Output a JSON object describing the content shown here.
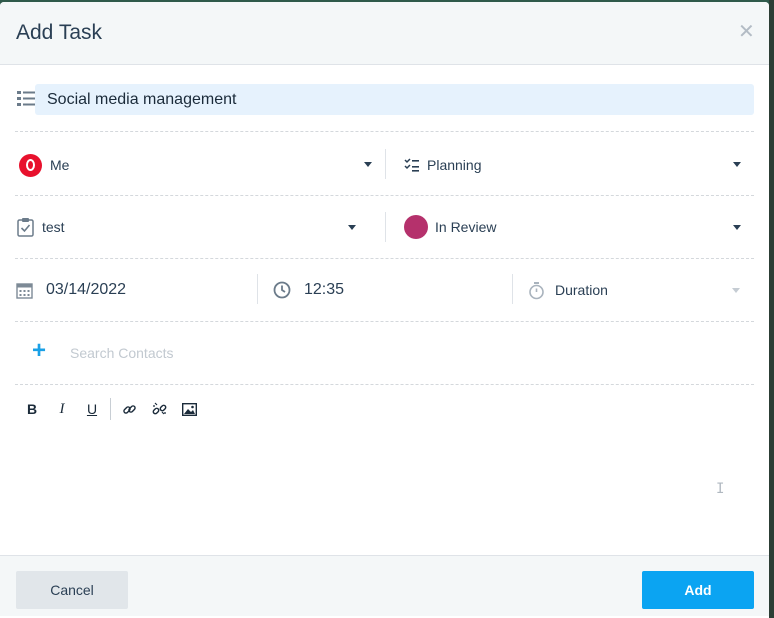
{
  "dialog": {
    "title": "Add Task",
    "close_icon": "close-icon"
  },
  "task": {
    "name": "Social media management",
    "name_icon": "list-icon"
  },
  "assignee": {
    "label": "Me",
    "icon": "avatar-icon"
  },
  "pipeline": {
    "label": "Planning",
    "icon": "checklist-icon"
  },
  "board": {
    "label": "test",
    "icon": "clipboard-check-icon"
  },
  "status": {
    "label": "In Review",
    "color": "#b5316c"
  },
  "schedule": {
    "date": "03/14/2022",
    "date_icon": "calendar-icon",
    "time": "12:35",
    "time_icon": "clock-icon",
    "duration_placeholder": "Duration",
    "duration_icon": "stopwatch-icon"
  },
  "contacts": {
    "placeholder": "Search Contacts",
    "add_icon": "plus-icon"
  },
  "toolbar": {
    "bold": "B",
    "italic": "I",
    "underline": "U",
    "link_icon": "link-icon",
    "unlink_icon": "unlink-icon",
    "image_icon": "image-icon"
  },
  "footer": {
    "cancel_label": "Cancel",
    "add_label": "Add"
  },
  "colors": {
    "accent": "#0ba4f2",
    "avatar": "#e8112d"
  }
}
